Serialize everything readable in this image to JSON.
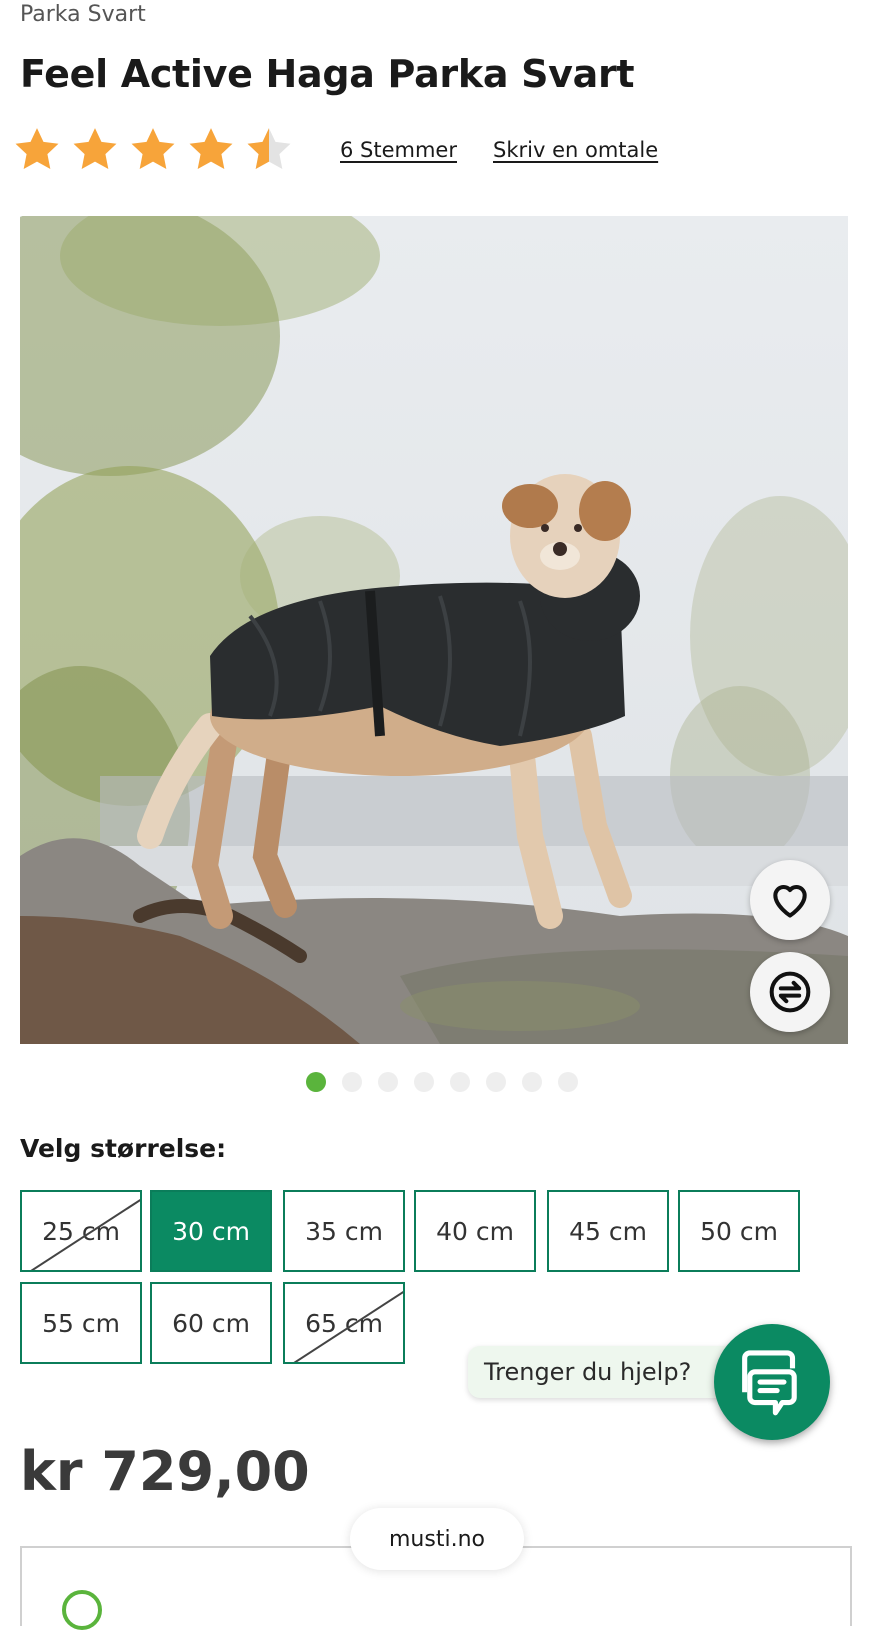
{
  "breadcrumb": "Parka Svart",
  "product": {
    "title": "Feel Active Haga Parka Svart",
    "rating_value": 4.5,
    "rating_max": 5,
    "votes_label": "6 Stemmer",
    "review_label": "Skriv en omtale",
    "price": "kr 729,00"
  },
  "gallery": {
    "image_description_icon": "dog-in-black-parka-photo",
    "slide_count": 8,
    "active_slide": 1,
    "wishlist_icon": "heart-icon",
    "compare_icon": "compare-arrows-icon"
  },
  "sizes": {
    "label": "Velg størrelse:",
    "options": [
      {
        "label": "25 cm",
        "state": "unavailable"
      },
      {
        "label": "30 cm",
        "state": "selected"
      },
      {
        "label": "35 cm",
        "state": "available"
      },
      {
        "label": "40 cm",
        "state": "available"
      },
      {
        "label": "45 cm",
        "state": "available"
      },
      {
        "label": "50 cm",
        "state": "available"
      },
      {
        "label": "55 cm",
        "state": "available"
      },
      {
        "label": "60 cm",
        "state": "available"
      },
      {
        "label": "65 cm",
        "state": "unavailable"
      }
    ]
  },
  "help": {
    "label": "Trenger du hjelp?",
    "icon": "chat-icon"
  },
  "browser": {
    "url": "musti.no"
  },
  "colors": {
    "brand_green": "#0b8a62",
    "dot_active": "#5ab43c",
    "star": "#f7a43a"
  }
}
